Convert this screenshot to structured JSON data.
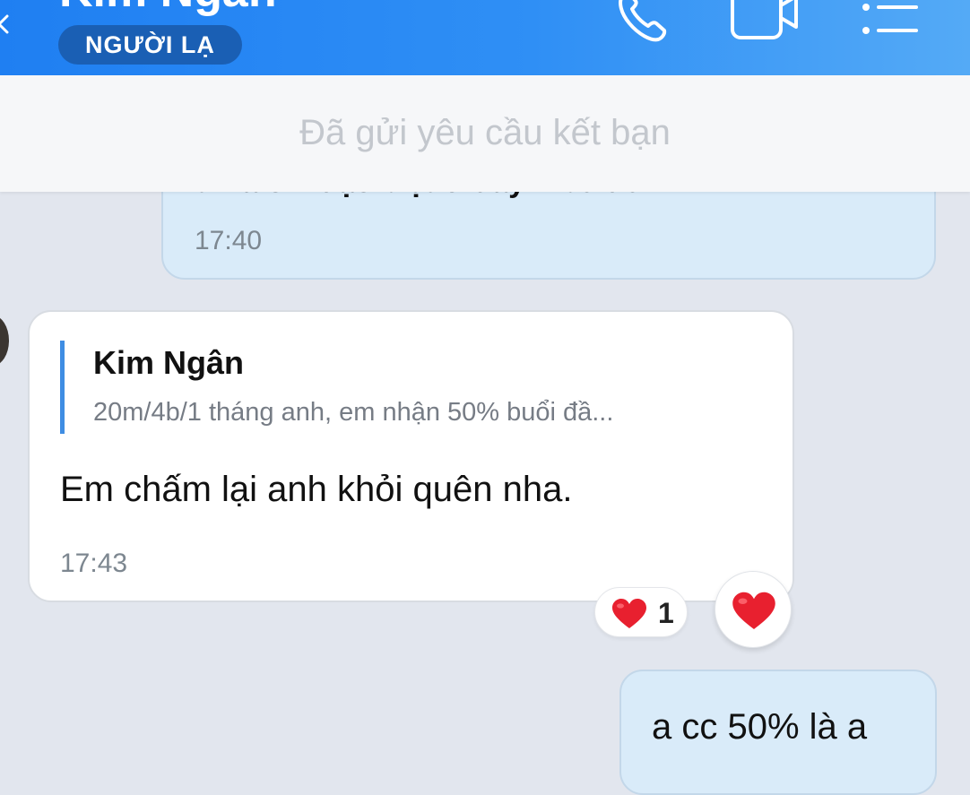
{
  "header": {
    "contact_name": "Kim Ngân",
    "badge": "NGƯỜI LẠ",
    "icons": [
      "back-chevron-icon",
      "phone-icon",
      "video-call-icon",
      "menu-list-icon"
    ]
  },
  "friend_request": {
    "status_text": "Đã gửi yêu cầu kết bạn"
  },
  "messages": [
    {
      "direction": "outgoing",
      "partial_text": "thì a chỉ đặc biệt ở đây k bỏ đó",
      "time": "17:40"
    },
    {
      "direction": "incoming",
      "quote": {
        "name": "Kim Ngân",
        "text": "20m/4b/1 tháng anh, em nhận 50% buổi đầ..."
      },
      "text": "Em chấm lại anh khỏi quên nha.",
      "time": "17:43",
      "reactions": {
        "icon": "heart-icon",
        "count": "1"
      }
    },
    {
      "direction": "outgoing",
      "text": "a cc 50% là a"
    }
  ],
  "colors": {
    "header_gradient_start": "#1f7ff2",
    "header_gradient_end": "#54aaf6",
    "badge_bg": "#1a5fb4",
    "outgoing_bubble": "#d9ebf9",
    "incoming_bubble": "#ffffff",
    "chat_background": "#e2e6ee",
    "quote_bar": "#3f8de3",
    "heart": "#e8202f"
  }
}
